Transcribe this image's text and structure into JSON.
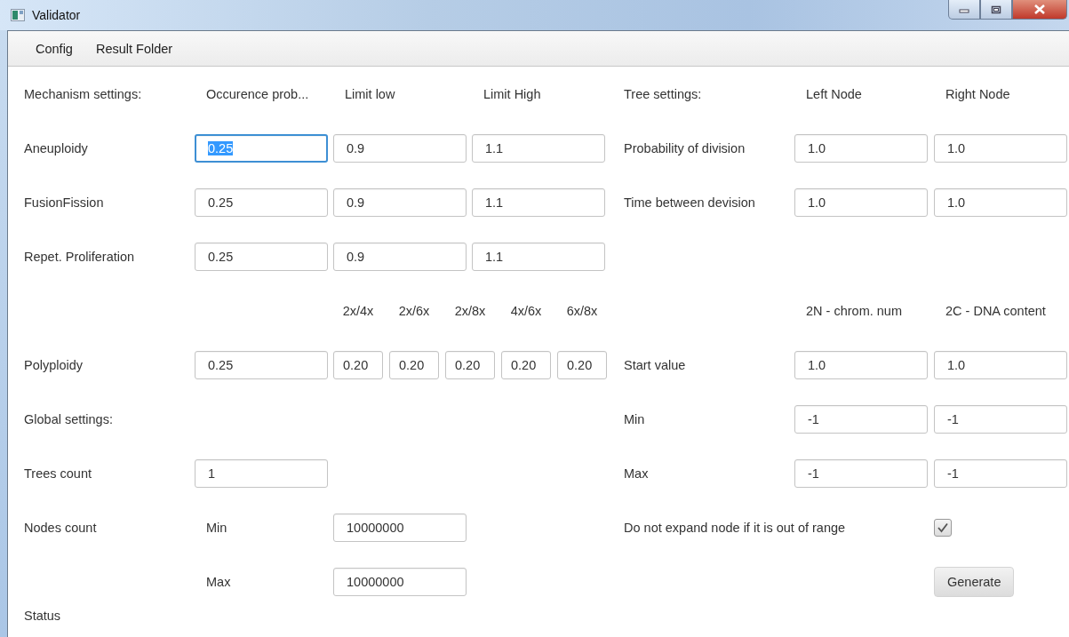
{
  "window": {
    "title": "Validator"
  },
  "menu": [
    "Config",
    "Result Folder"
  ],
  "mechanism": {
    "title": "Mechanism settings:",
    "columns": [
      "Occurence prob...",
      "Limit low",
      "Limit High"
    ],
    "rows": [
      {
        "label": "Aneuploidy",
        "fields": [
          {
            "value": "0.25",
            "focused": true
          },
          {
            "value": "0.9",
            "focused": false
          },
          {
            "value": "1.1",
            "focused": false
          }
        ]
      },
      {
        "label": "FusionFission",
        "fields": [
          {
            "value": "0.25",
            "focused": false
          },
          {
            "value": "0.9",
            "focused": false
          },
          {
            "value": "1.1",
            "focused": false
          }
        ]
      },
      {
        "label": "Repet. Proliferation",
        "fields": [
          {
            "value": "0.25",
            "focused": false
          },
          {
            "value": "0.9",
            "focused": false
          },
          {
            "value": "1.1",
            "focused": false
          }
        ]
      }
    ]
  },
  "polyploidy": {
    "label": "Polyploidy",
    "value": "0.25",
    "ratio_headers": [
      "2x/4x",
      "2x/6x",
      "2x/8x",
      "4x/6x",
      "6x/8x"
    ],
    "ratios": [
      "0.20",
      "0.20",
      "0.20",
      "0.20",
      "0.20"
    ]
  },
  "global": {
    "title": "Global settings:",
    "trees_count": {
      "label": "Trees count",
      "value": "1"
    },
    "nodes_count": {
      "label": "Nodes count",
      "min_label": "Min",
      "min": "10000000",
      "max_label": "Max",
      "max": "10000000"
    }
  },
  "tree": {
    "title": "Tree settings:",
    "columns": [
      "Left Node",
      "Right Node"
    ],
    "rows": [
      {
        "label": "Probability of division",
        "values": [
          "1.0",
          "1.0"
        ]
      },
      {
        "label": "Time between devision",
        "values": [
          "1.0",
          "1.0"
        ]
      }
    ]
  },
  "range": {
    "columns": [
      "2N - chrom. num",
      "2C - DNA content"
    ],
    "rows": [
      {
        "label": "Start value",
        "values": [
          "1.0",
          "1.0"
        ]
      },
      {
        "label": "Min",
        "values": [
          "-1",
          "-1"
        ]
      },
      {
        "label": "Max",
        "values": [
          "-1",
          "-1"
        ]
      }
    ]
  },
  "option": {
    "label": "Do not expand node if it is out of range",
    "checked": true
  },
  "generate_button": "Generate",
  "status": "Status"
}
